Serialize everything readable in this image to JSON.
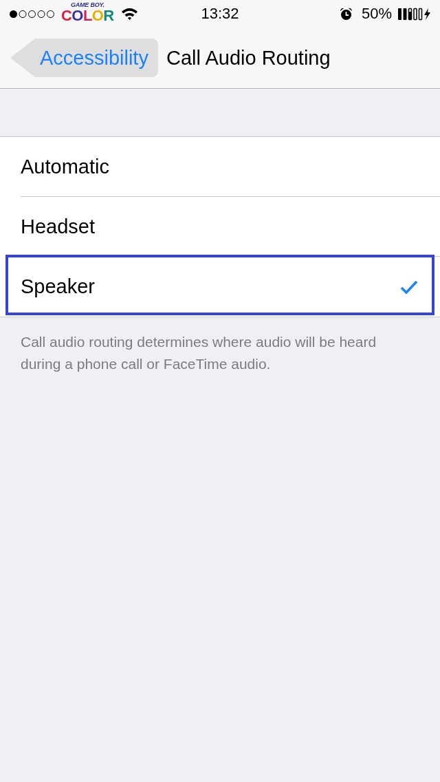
{
  "status_bar": {
    "carrier": {
      "line_1": "GAME BOY.",
      "line_2": "COLOR"
    },
    "time": "13:32",
    "battery_percent": "50%"
  },
  "nav_bar": {
    "back_button": "Accessibility",
    "title": "Call Audio Routing"
  },
  "options": [
    {
      "label": "Automatic",
      "selected": false,
      "highlighted": false
    },
    {
      "label": "Headset",
      "selected": false,
      "highlighted": false
    },
    {
      "label": "Speaker",
      "selected": true,
      "highlighted": true
    }
  ],
  "footer": "Call audio routing determines where audio will be heard during a phone call or FaceTime audio."
}
